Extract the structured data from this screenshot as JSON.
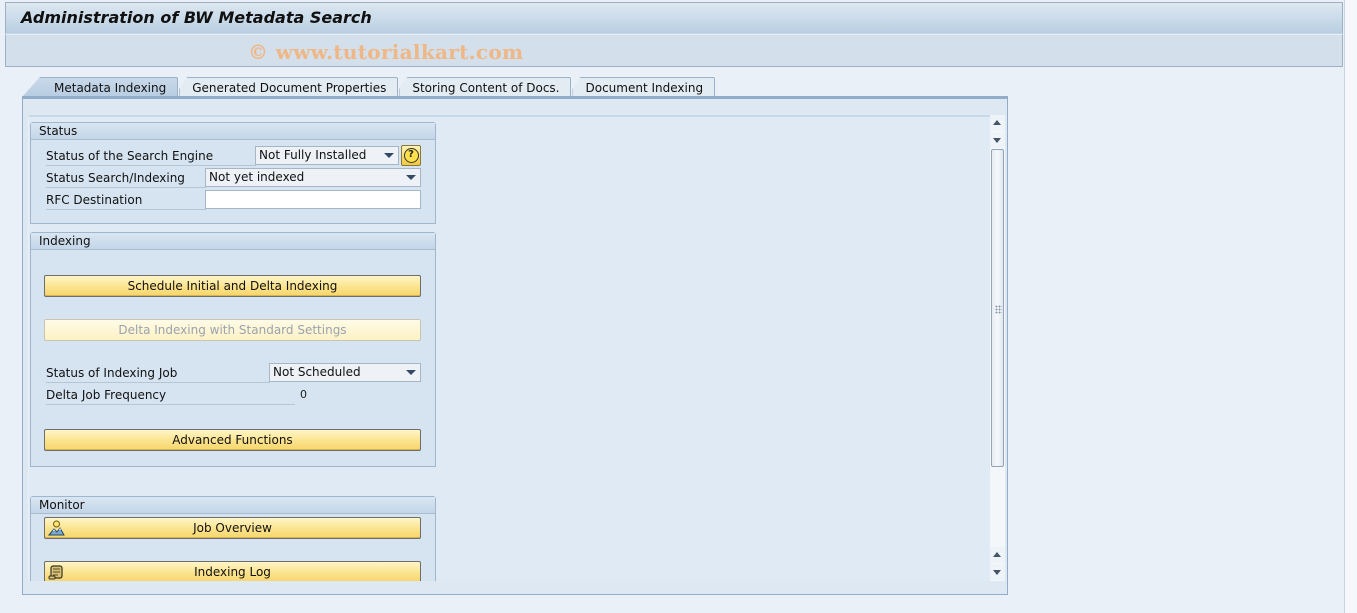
{
  "window": {
    "title": "Administration of BW Metadata Search",
    "watermark": "© www.tutorialkart.com"
  },
  "tabs": [
    {
      "label": "Metadata Indexing",
      "active": true
    },
    {
      "label": "Generated Document Properties",
      "active": false
    },
    {
      "label": "Storing Content of Docs.",
      "active": false
    },
    {
      "label": "Document Indexing",
      "active": false
    }
  ],
  "status_group": {
    "title": "Status",
    "search_engine": {
      "label": "Status of the Search Engine",
      "value": "Not Fully Installed",
      "help_icon": "help-question-icon"
    },
    "search_indexing": {
      "label": "Status Search/Indexing",
      "value": "Not yet indexed"
    },
    "rfc_destination": {
      "label": "RFC Destination",
      "value": ""
    }
  },
  "indexing_group": {
    "title": "Indexing",
    "schedule_button": "Schedule Initial and Delta Indexing",
    "delta_button": "Delta Indexing with Standard Settings",
    "indexing_job": {
      "label": "Status of Indexing Job",
      "value": "Not Scheduled"
    },
    "delta_frequency": {
      "label": "Delta Job Frequency",
      "value": "0"
    },
    "advanced_button": "Advanced Functions"
  },
  "monitor_group": {
    "title": "Monitor",
    "job_overview_button": {
      "label": "Job Overview",
      "icon": "job-overview-icon"
    },
    "indexing_log_button": {
      "label": "Indexing Log",
      "icon": "log-scroll-icon"
    }
  },
  "colors": {
    "button_yellow": "#fbe38d",
    "panel_bg": "#dfeaf5",
    "watermark": "#efb786"
  }
}
